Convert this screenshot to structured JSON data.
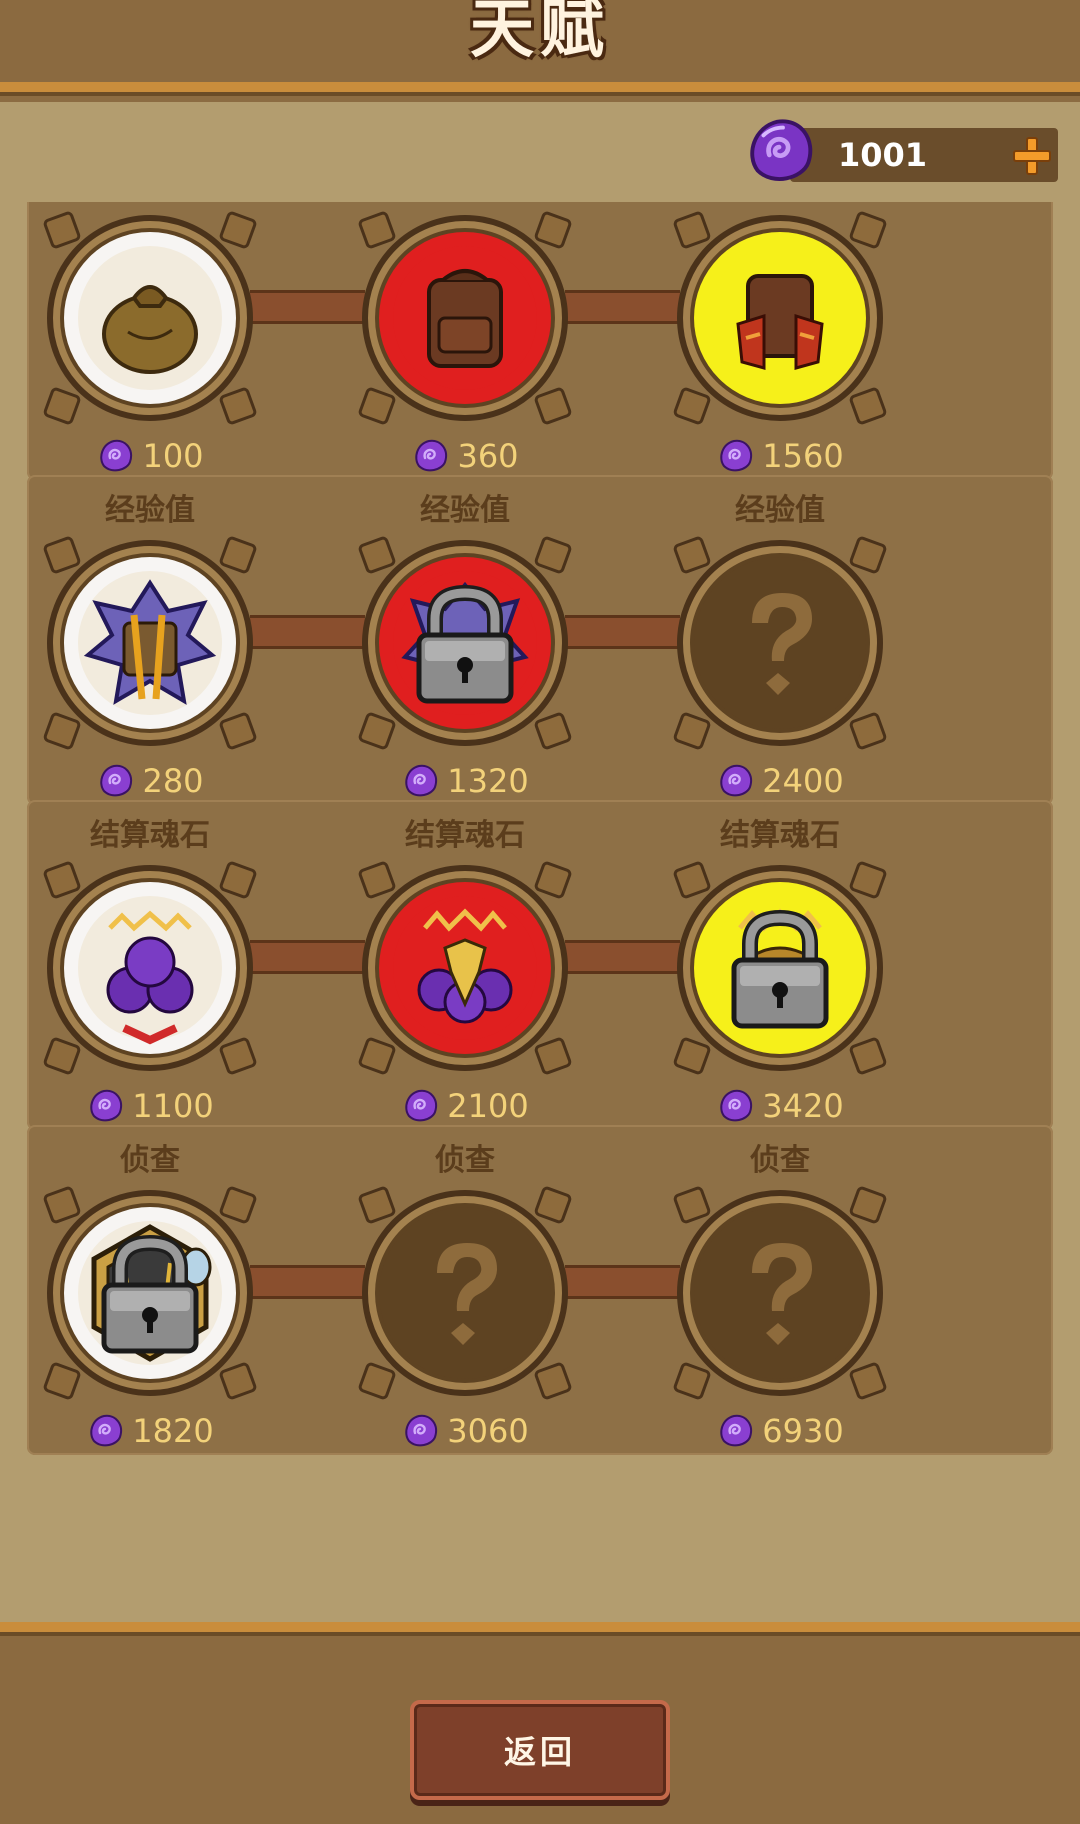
{
  "header": {
    "title": "天赋"
  },
  "currency": {
    "gem_icon": "soul-stone-icon",
    "value": "1001",
    "add_icon": "plus-icon",
    "accent": "#f39b2a"
  },
  "colors": {
    "gem": "#8a3fd1",
    "tier_selected": "#ffffff",
    "tier_red": "#e01f1f",
    "tier_yellow": "#f6f01a"
  },
  "rows": [
    {
      "name": "背包",
      "nodes": [
        {
          "label": "背包",
          "icon": "sack-bag-icon",
          "glow": "white",
          "locked": false,
          "unknown": false,
          "cost": "100"
        },
        {
          "label": "背包",
          "icon": "backpack-icon",
          "glow": "red",
          "locked": false,
          "unknown": false,
          "cost": "360"
        },
        {
          "label": "背包",
          "icon": "armored-backpack-icon",
          "glow": "yellow",
          "locked": false,
          "unknown": false,
          "cost": "1560"
        }
      ]
    },
    {
      "name": "经验值",
      "nodes": [
        {
          "label": "经验值",
          "icon": "spiked-tome-icon",
          "glow": "white",
          "locked": false,
          "unknown": false,
          "cost": "280"
        },
        {
          "label": "经验值",
          "icon": "rune-tome-icon",
          "glow": "red",
          "locked": true,
          "unknown": false,
          "cost": "1320"
        },
        {
          "label": "经验值",
          "icon": "question-mark-icon",
          "glow": "none",
          "locked": false,
          "unknown": true,
          "cost": "2400"
        }
      ]
    },
    {
      "name": "结算魂石",
      "nodes": [
        {
          "label": "结算魂石",
          "icon": "soul-stone-pile-icon",
          "glow": "white",
          "locked": false,
          "unknown": false,
          "cost": "1100"
        },
        {
          "label": "结算魂石",
          "icon": "soul-stone-crown-icon",
          "glow": "red",
          "locked": false,
          "unknown": false,
          "cost": "2100"
        },
        {
          "label": "结算魂石",
          "icon": "soul-stone-treasure-icon",
          "glow": "yellow",
          "locked": true,
          "unknown": false,
          "cost": "3420"
        }
      ]
    },
    {
      "name": "侦查",
      "nodes": [
        {
          "label": "侦查",
          "icon": "scout-map-icon",
          "glow": "white",
          "locked": true,
          "unknown": false,
          "cost": "1820"
        },
        {
          "label": "侦查",
          "icon": "question-mark-icon",
          "glow": "none",
          "locked": false,
          "unknown": true,
          "cost": "3060"
        },
        {
          "label": "侦查",
          "icon": "question-mark-icon",
          "glow": "none",
          "locked": false,
          "unknown": true,
          "cost": "6930"
        }
      ]
    }
  ],
  "footer": {
    "back_label": "返回"
  }
}
